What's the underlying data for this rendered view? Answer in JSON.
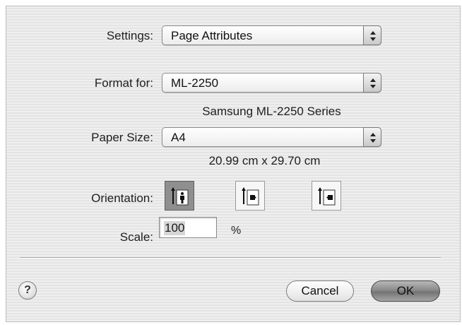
{
  "settings": {
    "label": "Settings:",
    "value": "Page Attributes"
  },
  "format_for": {
    "label": "Format for:",
    "value": "ML-2250",
    "description": "Samsung ML-2250 Series"
  },
  "paper_size": {
    "label": "Paper Size:",
    "value": "A4",
    "dimensions": "20.99 cm x 29.70 cm"
  },
  "orientation": {
    "label": "Orientation:",
    "options": [
      "portrait",
      "landscape-left",
      "landscape-right"
    ],
    "selected": "portrait"
  },
  "scale": {
    "label": "Scale:",
    "value": "100",
    "unit": "%"
  },
  "buttons": {
    "help": "?",
    "cancel": "Cancel",
    "ok": "OK"
  }
}
